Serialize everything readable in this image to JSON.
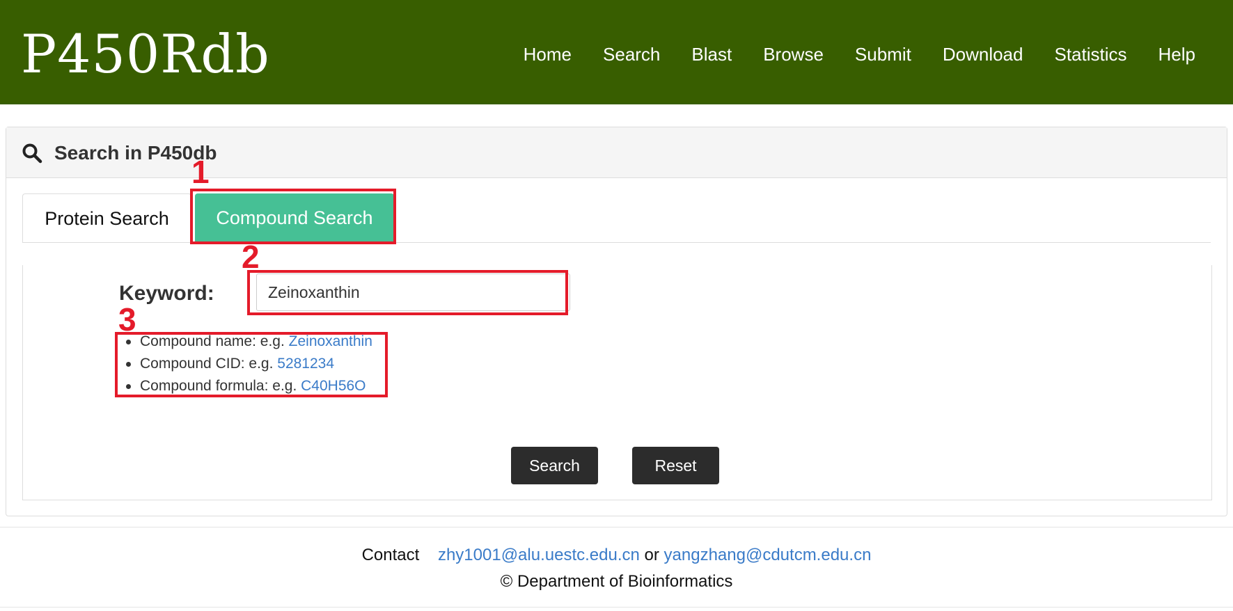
{
  "header": {
    "logo": "P450Rdb",
    "nav": [
      "Home",
      "Search",
      "Blast",
      "Browse",
      "Submit",
      "Download",
      "Statistics",
      "Help"
    ]
  },
  "panel": {
    "title": "Search in P450db",
    "tabs": {
      "protein": "Protein Search",
      "compound": "Compound Search"
    },
    "keyword_label": "Keyword:",
    "keyword_value": "Zeinoxanthin",
    "hints": [
      {
        "prefix": "Compound name: e.g. ",
        "example": "Zeinoxanthin"
      },
      {
        "prefix": "Compound CID: e.g. ",
        "example": "5281234"
      },
      {
        "prefix": "Compound formula: e.g. ",
        "example": "C40H56O"
      }
    ],
    "search_button": "Search",
    "reset_button": "Reset"
  },
  "annotations": [
    "1",
    "2",
    "3"
  ],
  "footer": {
    "contact_label": "Contact",
    "email1": "zhy1001@alu.uestc.edu.cn",
    "or": "or",
    "email2": "yangzhang@cdutcm.edu.cn",
    "copyright": "© Department of Bioinformatics"
  },
  "colors": {
    "header_bg": "#385e00",
    "active_tab": "#46c095",
    "annotation": "#e41b2a",
    "link": "#3a7bc8",
    "button_bg": "#2c2c2c"
  },
  "icons": {
    "panel_title_icon": "search-icon"
  }
}
